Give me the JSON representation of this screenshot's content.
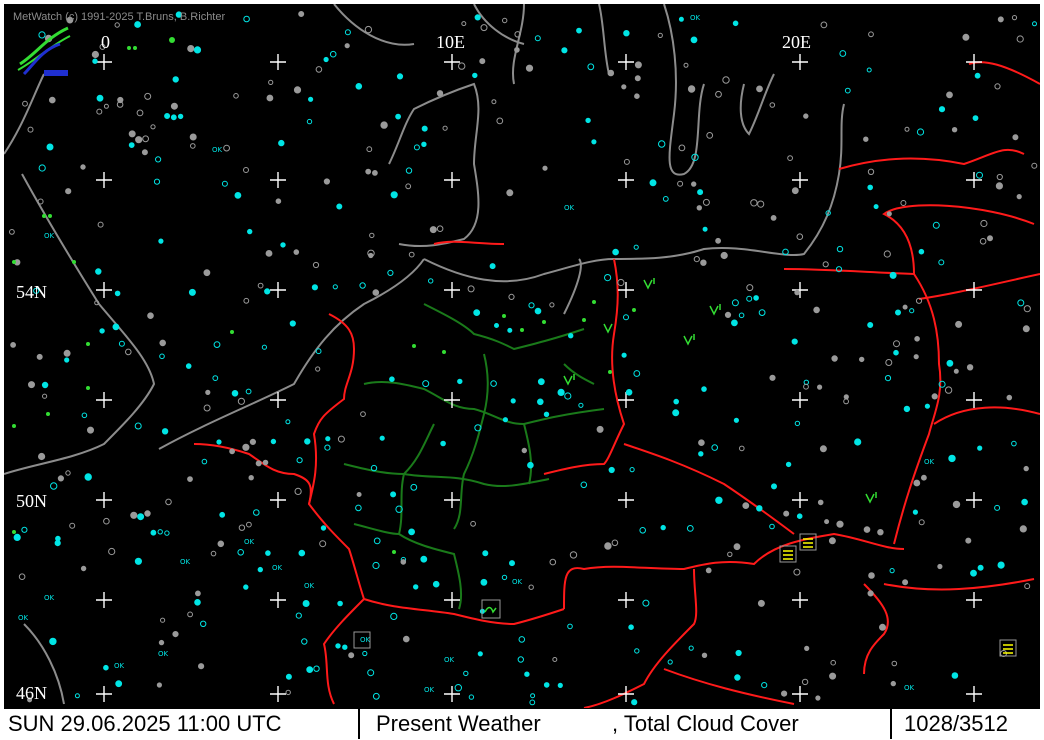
{
  "app": {
    "copyright": "MetWatch  (c) 1991-2025 T.Bruns, B.Richter"
  },
  "map": {
    "grid_labels": {
      "lon_0": "0",
      "lon_10": "10E",
      "lon_20": "20E",
      "lat_54": "54N",
      "lat_50": "50N",
      "lat_46": "46N"
    },
    "station_text": "OK",
    "colors": {
      "background": "#000000",
      "coast": "#8c8c8c",
      "borders": "#ff1a1a",
      "states": "#1a7a1a",
      "cyan_stations": "#00e5e5",
      "gray_stations": "#9a9a9a",
      "weather_green": "#33dd33",
      "weather_yellow": "#ffff00"
    },
    "icons": [
      "metwatch-logo-icon",
      "plus-grid-icon",
      "station-circle-icon",
      "rain-symbol-icon",
      "thunderstorm-symbol-icon",
      "fog-symbol-icon"
    ]
  },
  "statusbar": {
    "datetime": "SUN 29.06.2025 11:00 UTC",
    "product": "Present Weather",
    "secondary": ", Total Cloud Cover",
    "counter": "1028/3512"
  }
}
